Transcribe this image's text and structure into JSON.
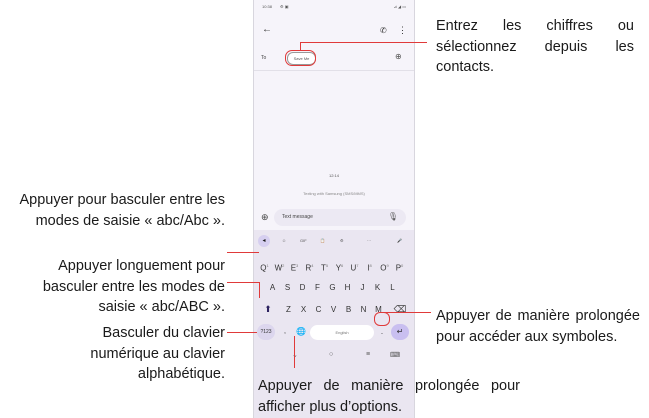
{
  "status_bar": {
    "time": "10:38",
    "indicators": "⚙ ▣",
    "right": "⊿ ◢ ▭"
  },
  "message": {
    "to_label": "To",
    "recipient_chip": "Save Me",
    "date_label": "12:14",
    "sending_label": "Texting with Samsung (SMS/MMS)",
    "compose_placeholder": "Text message"
  },
  "keyboard": {
    "toolbar": [
      "◂",
      "☺",
      "GIF",
      "📋",
      "⚙",
      "···",
      "🎤"
    ],
    "row1": [
      {
        "key": "Q",
        "alt": "1"
      },
      {
        "key": "W",
        "alt": "2"
      },
      {
        "key": "E",
        "alt": "3"
      },
      {
        "key": "R",
        "alt": "4"
      },
      {
        "key": "T",
        "alt": "5"
      },
      {
        "key": "Y",
        "alt": "6"
      },
      {
        "key": "U",
        "alt": "7"
      },
      {
        "key": "I",
        "alt": "8"
      },
      {
        "key": "O",
        "alt": "9"
      },
      {
        "key": "P",
        "alt": "0"
      }
    ],
    "row2": [
      "A",
      "S",
      "D",
      "F",
      "G",
      "H",
      "J",
      "K",
      "L"
    ],
    "row3": [
      "Z",
      "X",
      "C",
      "V",
      "B",
      "N",
      "M"
    ],
    "symbols_key": "?123",
    "comma_key": ",",
    "space_label": "English",
    "period_key": "."
  },
  "annotations": {
    "top_right": "Entrez les chiffres ou sélectionnez depuis les contacts.",
    "left_1": "Appuyer pour basculer entre les modes de saisie « abc/Abc ».",
    "left_2": "Appuyer longuement pour basculer entre les modes de saisie « abc/ABC ».",
    "left_3": "Basculer du clavier numérique au clavier alphabétique.",
    "right_bottom": "Appuyer de manière prolongée pour accéder aux symboles.",
    "bottom": "Appuyer de manière prolongée pour afficher plus d’options."
  },
  "accent_color": "#e03a3a"
}
